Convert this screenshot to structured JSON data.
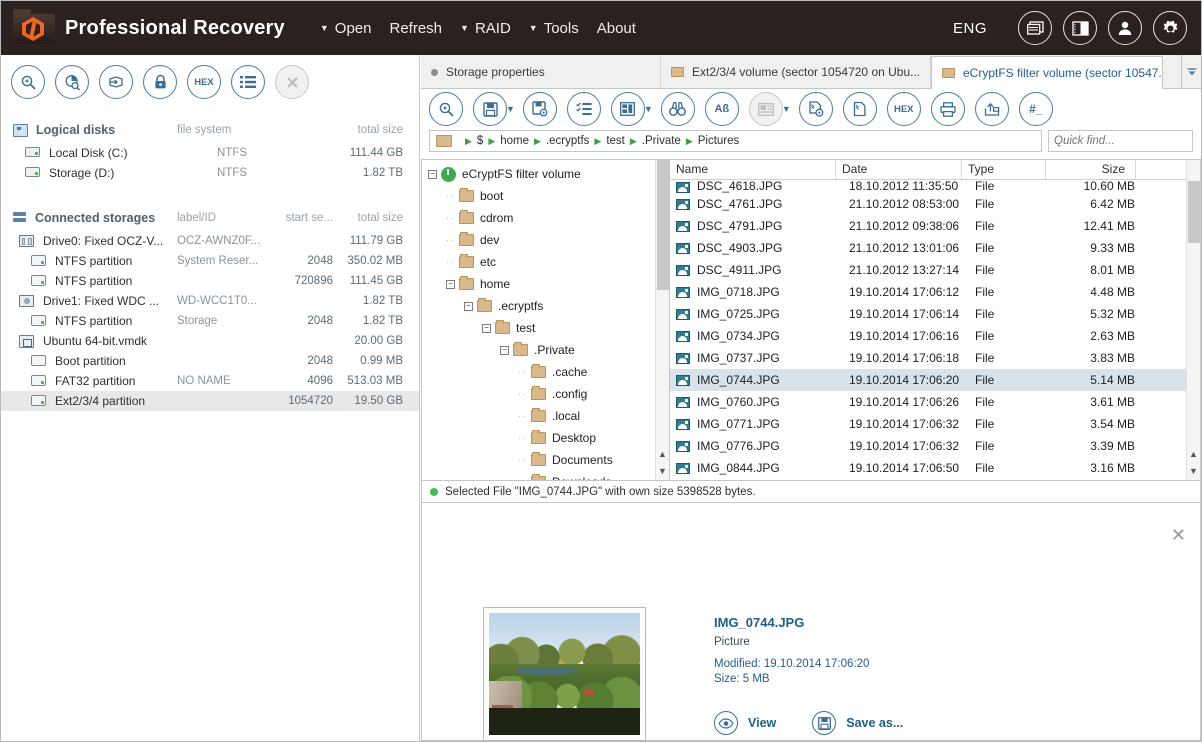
{
  "header": {
    "brand": "Professional Recovery",
    "logo_icon": "app-logo-icon",
    "menu": [
      {
        "label": "Open",
        "caret": "▼",
        "has_caret": true
      },
      {
        "label": "Refresh",
        "caret": "",
        "has_caret": false
      },
      {
        "label": "RAID",
        "caret": "▼",
        "has_caret": true
      },
      {
        "label": "Tools",
        "caret": "▼",
        "has_caret": true
      },
      {
        "label": "About",
        "caret": "",
        "has_caret": false
      }
    ],
    "language": "ENG",
    "icons": [
      "windows-icon",
      "split-view-icon",
      "user-icon",
      "gear-icon"
    ],
    "background_color": "#2b211e"
  },
  "left_panel": {
    "toolbar": [
      {
        "name": "search-disk-icon",
        "glyph": "search"
      },
      {
        "name": "disk-scan-icon",
        "glyph": "diskscan"
      },
      {
        "name": "open-image-icon",
        "glyph": "openimage"
      },
      {
        "name": "lock-icon",
        "glyph": "lock"
      },
      {
        "name": "hex-icon",
        "glyph": "HEX"
      },
      {
        "name": "list-icon",
        "glyph": "list"
      },
      {
        "name": "close-icon",
        "glyph": "X",
        "disabled": true
      }
    ],
    "logical_disks": {
      "title": "Logical disks",
      "icon": "monitor-icon",
      "columns": [
        "file system",
        "total size"
      ],
      "rows": [
        {
          "name": "Local Disk (C:)",
          "fs": "NTFS",
          "size": "111.44 GB",
          "icon": "disk-icon"
        },
        {
          "name": "Storage (D:)",
          "fs": "NTFS",
          "size": "1.82 TB",
          "icon": "disk-icon"
        }
      ]
    },
    "connected_storages": {
      "title": "Connected storages",
      "icon": "storage-stack-icon",
      "columns": [
        "label/ID",
        "start se...",
        "total size"
      ],
      "rows": [
        {
          "name": "Drive0: Fixed OCZ-V...",
          "label": "OCZ-AWNZ0F...",
          "start": "",
          "size": "111.79 GB",
          "indent": 0,
          "icon": "drive-icon",
          "selected": false
        },
        {
          "name": "NTFS partition",
          "label": "System Reser...",
          "start": "2048",
          "size": "350.02 MB",
          "indent": 1,
          "icon": "partition-icon",
          "selected": false
        },
        {
          "name": "NTFS partition",
          "label": "",
          "start": "720896",
          "size": "111.45 GB",
          "indent": 1,
          "icon": "partition-icon",
          "selected": false
        },
        {
          "name": "Drive1: Fixed WDC ...",
          "label": "WD-WCC1T0...",
          "start": "",
          "size": "1.82 TB",
          "indent": 0,
          "icon": "round-drive-icon",
          "selected": false
        },
        {
          "name": "NTFS partition",
          "label": "Storage",
          "start": "2048",
          "size": "1.82 TB",
          "indent": 1,
          "icon": "partition-icon",
          "selected": false
        },
        {
          "name": "Ubuntu 64-bit.vmdk",
          "label": "",
          "start": "",
          "size": "20.00 GB",
          "indent": 0,
          "icon": "vmdk-icon",
          "selected": false
        },
        {
          "name": "Boot partition",
          "label": "",
          "start": "2048",
          "size": "0.99 MB",
          "indent": 1,
          "icon": "partition-plain-icon",
          "selected": false
        },
        {
          "name": "FAT32 partition",
          "label": "NO NAME",
          "start": "4096",
          "size": "513.03 MB",
          "indent": 1,
          "icon": "partition-icon",
          "selected": false
        },
        {
          "name": "Ext2/3/4 partition",
          "label": "",
          "start": "1054720",
          "size": "19.50 GB",
          "indent": 1,
          "icon": "partition-icon",
          "selected": true
        }
      ]
    }
  },
  "tabs": [
    {
      "label": "Storage properties",
      "type": "dot",
      "active": false,
      "closable": false
    },
    {
      "label": "Ext2/3/4 volume (sector 1054720 on Ubu...",
      "type": "folder",
      "active": false,
      "closable": false
    },
    {
      "label": "eCryptFS filter volume (sector 10547...",
      "type": "folder",
      "active": true,
      "closable": true,
      "close_glyph": "✕"
    }
  ],
  "tab_overflow_icon": "chevron-down-icon",
  "main_toolbar": [
    {
      "name": "search-icon",
      "glyph": "search",
      "caret": false
    },
    {
      "name": "save-icon",
      "glyph": "save",
      "caret": true
    },
    {
      "name": "save-settings-icon",
      "glyph": "savecfg",
      "caret": false
    },
    {
      "name": "checklist-icon",
      "glyph": "checklist",
      "caret": false
    },
    {
      "name": "layout-icon",
      "glyph": "layout",
      "caret": true
    },
    {
      "name": "binoculars-icon",
      "glyph": "binoculars",
      "caret": false
    },
    {
      "name": "encoding-icon",
      "glyph": "Aß",
      "caret": false
    },
    {
      "name": "preview-pane-icon",
      "glyph": "preview",
      "caret": true,
      "disabled": true
    },
    {
      "name": "file-recovery-settings-icon",
      "glyph": "filecfg",
      "caret": false
    },
    {
      "name": "copy-file-icon",
      "glyph": "filecopy",
      "caret": false
    },
    {
      "name": "hex-icon",
      "glyph": "HEX",
      "caret": false
    },
    {
      "name": "print-icon",
      "glyph": "print",
      "caret": false
    },
    {
      "name": "export-icon",
      "glyph": "export",
      "caret": false
    },
    {
      "name": "hash-icon",
      "glyph": "#_",
      "caret": false
    }
  ],
  "breadcrumb": {
    "folder_icon": "folder-icon",
    "items": [
      "$",
      "home",
      ".ecryptfs",
      "test",
      ".Private",
      "Pictures"
    ]
  },
  "quick_find": {
    "placeholder": "Quick find...",
    "value": "",
    "icon": "search-icon"
  },
  "tree": {
    "nodes": [
      {
        "label": "eCryptFS filter volume",
        "depth": 0,
        "expander": "minus",
        "icon": "volume-icon"
      },
      {
        "label": "boot",
        "depth": 1,
        "expander": "dots",
        "icon": "folder-icon"
      },
      {
        "label": "cdrom",
        "depth": 1,
        "expander": "dots",
        "icon": "folder-icon"
      },
      {
        "label": "dev",
        "depth": 1,
        "expander": "dots",
        "icon": "folder-icon"
      },
      {
        "label": "etc",
        "depth": 1,
        "expander": "dots",
        "icon": "folder-icon"
      },
      {
        "label": "home",
        "depth": 1,
        "expander": "minus",
        "icon": "folder-icon"
      },
      {
        "label": ".ecryptfs",
        "depth": 2,
        "expander": "minus",
        "icon": "folder-icon"
      },
      {
        "label": "test",
        "depth": 3,
        "expander": "minus",
        "icon": "folder-icon"
      },
      {
        "label": ".Private",
        "depth": 4,
        "expander": "minus",
        "icon": "folder-icon"
      },
      {
        "label": ".cache",
        "depth": 5,
        "expander": "dots",
        "icon": "folder-icon"
      },
      {
        "label": ".config",
        "depth": 5,
        "expander": "dots",
        "icon": "folder-icon"
      },
      {
        "label": ".local",
        "depth": 5,
        "expander": "dots",
        "icon": "folder-icon"
      },
      {
        "label": "Desktop",
        "depth": 5,
        "expander": "dots",
        "icon": "folder-icon"
      },
      {
        "label": "Documents",
        "depth": 5,
        "expander": "dots",
        "icon": "folder-icon"
      },
      {
        "label": "Downloads",
        "depth": 5,
        "expander": "dots",
        "icon": "folder-icon"
      }
    ]
  },
  "file_list": {
    "columns": [
      "Name",
      "Date",
      "Type",
      "Size"
    ],
    "rows": [
      {
        "name": "DSC_4618.JPG",
        "date": "18.10.2012 11:35:50",
        "type": "File",
        "size": "10.60 MB",
        "selected": false
      },
      {
        "name": "DSC_4761.JPG",
        "date": "21.10.2012 08:53:00",
        "type": "File",
        "size": "6.42 MB",
        "selected": false
      },
      {
        "name": "DSC_4791.JPG",
        "date": "21.10.2012 09:38:06",
        "type": "File",
        "size": "12.41 MB",
        "selected": false
      },
      {
        "name": "DSC_4903.JPG",
        "date": "21.10.2012 13:01:06",
        "type": "File",
        "size": "9.33 MB",
        "selected": false
      },
      {
        "name": "DSC_4911.JPG",
        "date": "21.10.2012 13:27:14",
        "type": "File",
        "size": "8.01 MB",
        "selected": false
      },
      {
        "name": "IMG_0718.JPG",
        "date": "19.10.2014 17:06:12",
        "type": "File",
        "size": "4.48 MB",
        "selected": false
      },
      {
        "name": "IMG_0725.JPG",
        "date": "19.10.2014 17:06:14",
        "type": "File",
        "size": "5.32 MB",
        "selected": false
      },
      {
        "name": "IMG_0734.JPG",
        "date": "19.10.2014 17:06:16",
        "type": "File",
        "size": "2.63 MB",
        "selected": false
      },
      {
        "name": "IMG_0737.JPG",
        "date": "19.10.2014 17:06:18",
        "type": "File",
        "size": "3.83 MB",
        "selected": false
      },
      {
        "name": "IMG_0744.JPG",
        "date": "19.10.2014 17:06:20",
        "type": "File",
        "size": "5.14 MB",
        "selected": true
      },
      {
        "name": "IMG_0760.JPG",
        "date": "19.10.2014 17:06:26",
        "type": "File",
        "size": "3.61 MB",
        "selected": false
      },
      {
        "name": "IMG_0771.JPG",
        "date": "19.10.2014 17:06:32",
        "type": "File",
        "size": "3.54 MB",
        "selected": false
      },
      {
        "name": "IMG_0776.JPG",
        "date": "19.10.2014 17:06:32",
        "type": "File",
        "size": "3.39 MB",
        "selected": false
      },
      {
        "name": "IMG_0844.JPG",
        "date": "19.10.2014 17:06:50",
        "type": "File",
        "size": "3.16 MB",
        "selected": false
      }
    ]
  },
  "status": {
    "text": "Selected File \"IMG_0744.JPG\" with own size 5398528 bytes.",
    "dot_color": "#3ebf55"
  },
  "detail": {
    "close_glyph": "✕",
    "thumbnail_name": "file-thumbnail",
    "name": "IMG_0744.JPG",
    "type": "Picture",
    "modified": "Modified: 19.10.2014 17:06:20",
    "size": "Size: 5 MB",
    "buttons": [
      {
        "label": "View",
        "icon": "eye-icon"
      },
      {
        "label": "Save as...",
        "icon": "save-icon"
      }
    ]
  }
}
